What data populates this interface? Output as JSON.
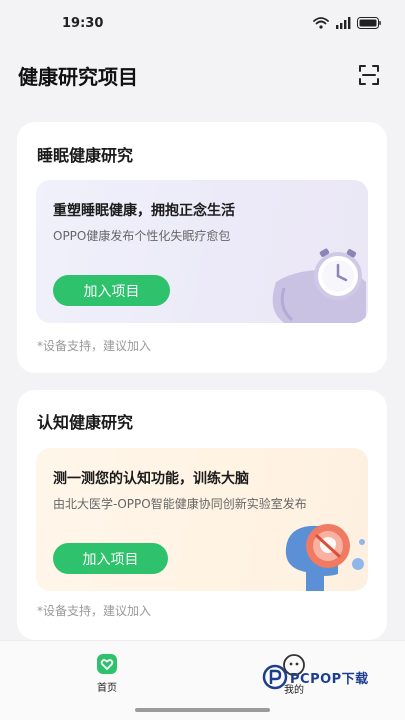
{
  "status_bar": {
    "time": "19:30"
  },
  "header": {
    "title": "健康研究项目"
  },
  "cards": [
    {
      "title": "睡眠健康研究",
      "headline": "重塑睡眠健康，拥抱正念生活",
      "subtitle": "OPPO健康发布个性化失眠疗愈包",
      "button_label": "加入项目",
      "note": "*设备支持，建议加入"
    },
    {
      "title": "认知健康研究",
      "headline": "测一测您的认知功能，训练大脑",
      "subtitle": "由北大医学-OPPO智能健康协同创新实验室发布",
      "button_label": "加入项目",
      "note": "*设备支持，建议加入"
    }
  ],
  "bottom_nav": {
    "items": [
      {
        "label": "首页",
        "icon": "heart-home-icon",
        "active": true
      },
      {
        "label": "我的",
        "icon": "profile-face-icon",
        "active": false
      }
    ]
  },
  "watermark": {
    "text": "PCPOP下载"
  },
  "colors": {
    "accent": "#2dc26b",
    "background": "#f3f3f5"
  }
}
